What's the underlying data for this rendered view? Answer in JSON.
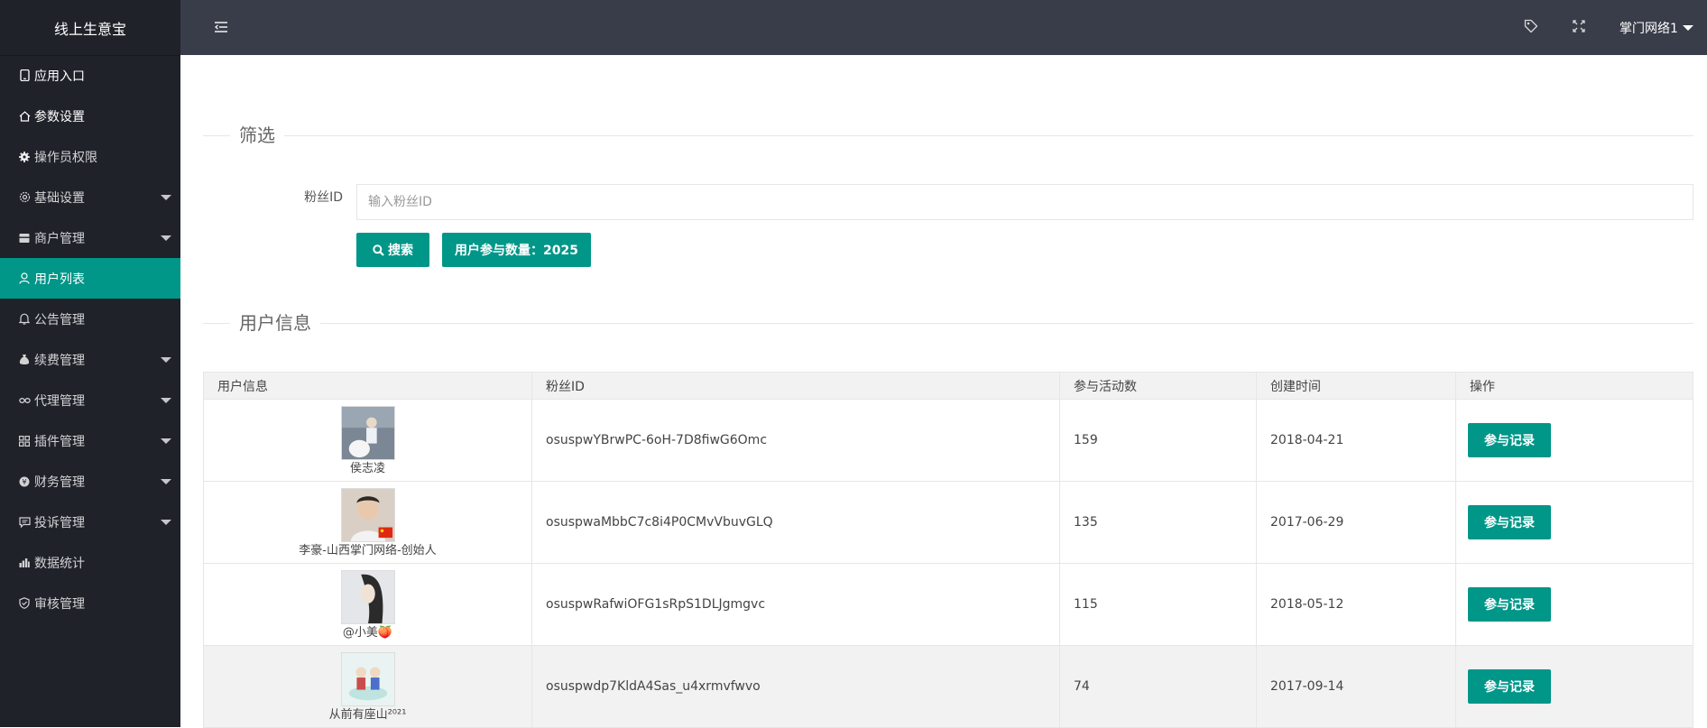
{
  "app": {
    "title": "线上生意宝"
  },
  "sidebar": {
    "items": [
      {
        "label": "应用入口",
        "icon": "tablet-icon",
        "expandable": false
      },
      {
        "label": "参数设置",
        "icon": "home-icon",
        "expandable": false
      },
      {
        "label": "操作员权限",
        "icon": "gear-icon",
        "expandable": false
      },
      {
        "label": "基础设置",
        "icon": "settings-icon",
        "expandable": true
      },
      {
        "label": "商户管理",
        "icon": "store-icon",
        "expandable": true
      },
      {
        "label": "用户列表",
        "icon": "user-icon",
        "expandable": false,
        "active": true
      },
      {
        "label": "公告管理",
        "icon": "bell-icon",
        "expandable": false
      },
      {
        "label": "续费管理",
        "icon": "money-bag-icon",
        "expandable": true
      },
      {
        "label": "代理管理",
        "icon": "link-icon",
        "expandable": true
      },
      {
        "label": "插件管理",
        "icon": "apps-icon",
        "expandable": true
      },
      {
        "label": "财务管理",
        "icon": "coin-icon",
        "expandable": true
      },
      {
        "label": "投诉管理",
        "icon": "message-icon",
        "expandable": true
      },
      {
        "label": "数据统计",
        "icon": "bar-chart-icon",
        "expandable": false
      },
      {
        "label": "审核管理",
        "icon": "shield-check-icon",
        "expandable": false
      }
    ]
  },
  "header": {
    "user_label": "掌门网络1",
    "icons": [
      "menu-fold-icon",
      "tag-icon",
      "fullscreen-icon"
    ]
  },
  "filter": {
    "section_title": "筛选",
    "fan_id_label": "粉丝ID",
    "fan_id_placeholder": "输入粉丝ID",
    "fan_id_value": "",
    "search_label": "搜索",
    "count_label": "用户参与数量：2025"
  },
  "userinfo": {
    "section_title": "用户信息",
    "columns": [
      "用户信息",
      "粉丝ID",
      "参与活动数",
      "创建时间",
      "操作"
    ],
    "rows": [
      {
        "name": "侯志凌",
        "fan_id": "osuspwYBrwPC-6oH-7D8fiwG6Omc",
        "activities": "159",
        "created": "2018-04-21",
        "action": "参与记录",
        "avatar_color": "#7b8794"
      },
      {
        "name": "李豪-山西掌门网络-创始人",
        "fan_id": "osuspwaMbbC7c8i4P0CMvVbuvGLQ",
        "activities": "135",
        "created": "2017-06-29",
        "action": "参与记录",
        "avatar_color": "#c9b8a8"
      },
      {
        "name": "@小美🍑",
        "fan_id": "osuspwRafwiOFG1sRpS1DLJgmgvc",
        "activities": "115",
        "created": "2018-05-12",
        "action": "参与记录",
        "avatar_color": "#cfd3d8"
      },
      {
        "name": "从前有座山²⁰²¹",
        "fan_id": "osuspwdp7KldA4Sas_u4xrmvfwvo",
        "activities": "74",
        "created": "2017-09-14",
        "action": "参与记录",
        "avatar_color": "#bfe3df"
      }
    ]
  },
  "colors": {
    "accent": "#009688",
    "sidebar_bg": "#20222A",
    "header_bg": "#393D49"
  }
}
